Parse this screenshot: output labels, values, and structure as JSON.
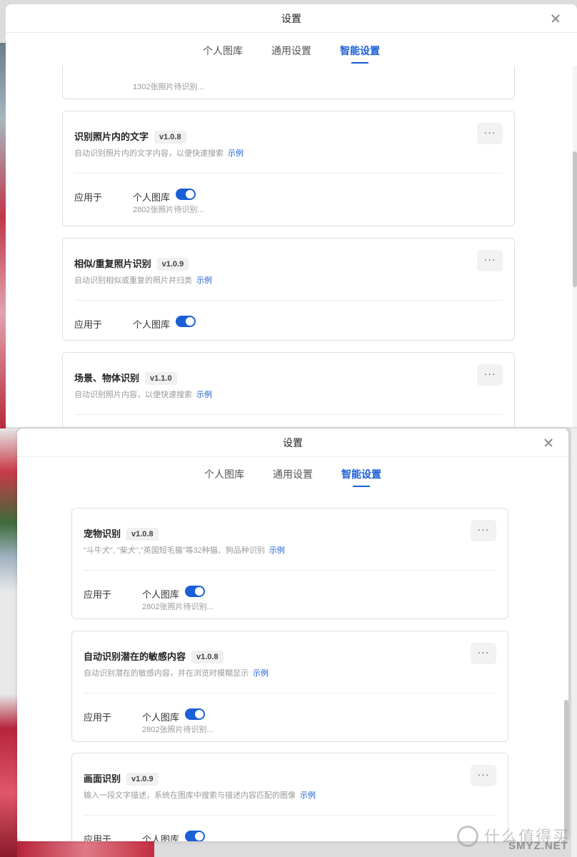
{
  "top_window": {
    "title": "设置",
    "tabs": [
      "个人图库",
      "通用设置",
      "智能设置"
    ],
    "active_tab": "智能设置",
    "partial_card_pending": "1302张照片待识别...",
    "cards": [
      {
        "title": "识别照片内的文字",
        "version": "v1.0.8",
        "description": "自动识别照片内的文字内容，以便快速搜索",
        "example": "示例",
        "more": "···",
        "apply_label": "应用于",
        "library": "个人图库",
        "enabled": true,
        "pending": "2802张照片待识别..."
      },
      {
        "title": "相似/重复照片识别",
        "version": "v1.0.9",
        "description": "自动识别相似或重复的照片并归类",
        "example": "示例",
        "more": "···",
        "apply_label": "应用于",
        "library": "个人图库",
        "enabled": true
      },
      {
        "title": "场景、物体识别",
        "version": "v1.1.0",
        "description": "自动识别照片内容，以便快速搜索",
        "example": "示例",
        "more": "···"
      }
    ]
  },
  "bottom_window": {
    "title": "设置",
    "tabs": [
      "个人图库",
      "通用设置",
      "智能设置"
    ],
    "active_tab": "智能设置",
    "cards": [
      {
        "title": "宠物识别",
        "version": "v1.0.8",
        "description": "\"斗牛犬\", \"柴犬\",\"英国短毛猫\"等32种猫、狗品种识别",
        "example": "示例",
        "more": "···",
        "apply_label": "应用于",
        "library": "个人图库",
        "enabled": true,
        "pending": "2802张照片待识别..."
      },
      {
        "title": "自动识别潜在的敏感内容",
        "version": "v1.0.8",
        "description": "自动识别潜在的敏感内容，并在浏览时模糊显示",
        "example": "示例",
        "more": "···",
        "apply_label": "应用于",
        "library": "个人图库",
        "enabled": true,
        "pending": "2802张照片待识别..."
      },
      {
        "title": "画面识别",
        "version": "v1.0.9",
        "description": "输入一段文字描述，系统在图库中搜索与描述内容匹配的图像",
        "example": "示例",
        "more": "···",
        "apply_label": "应用于",
        "library": "个人图库",
        "enabled": true
      }
    ]
  },
  "watermark": {
    "text_cn": "什么值得买",
    "text_en": "SMYZ.NET"
  }
}
